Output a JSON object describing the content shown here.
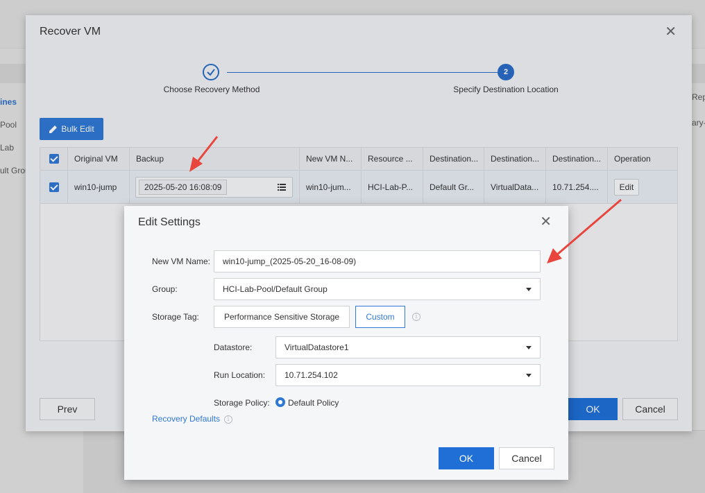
{
  "background": {
    "sidebar": [
      "ines",
      "Pool",
      "Lab",
      "ult Grou"
    ],
    "right_col": [
      "Rep",
      "ary-"
    ]
  },
  "recover_dialog": {
    "title": "Recover VM",
    "steps": [
      {
        "label": "Choose Recovery Method",
        "state": "done"
      },
      {
        "label": "Specify Destination Location",
        "number": "2",
        "state": "active"
      }
    ],
    "bulk_edit_label": "Bulk Edit",
    "table": {
      "columns": [
        "Original VM",
        "Backup",
        "New VM N...",
        "Resource ...",
        "Destination...",
        "Destination...",
        "Destination...",
        "Operation"
      ],
      "rows": [
        {
          "original_vm": "win10-jump",
          "backup": "2025-05-20 16:08:09",
          "new_vm_name": "win10-jum...",
          "resource": "HCI-Lab-P...",
          "dest1": "Default Gr...",
          "dest2": "VirtualData...",
          "dest3": "10.71.254....",
          "operation": "Edit"
        }
      ]
    },
    "prev_label": "Prev",
    "ok_label": "OK",
    "cancel_label": "Cancel"
  },
  "edit_dialog": {
    "title": "Edit Settings",
    "new_vm_name_label": "New VM Name:",
    "new_vm_name_value": "win10-jump_(2025-05-20_16-08-09)",
    "group_label": "Group:",
    "group_value": "HCI-Lab-Pool/Default Group",
    "storage_tag_label": "Storage Tag:",
    "storage_tag_options": [
      "Performance Sensitive Storage",
      "Custom"
    ],
    "storage_tag_selected": "Custom",
    "datastore_label": "Datastore:",
    "datastore_value": "VirtualDatastore1",
    "run_location_label": "Run Location:",
    "run_location_value": "10.71.254.102",
    "storage_policy_label": "Storage Policy:",
    "storage_policy_value": "Default Policy",
    "recovery_defaults_label": "Recovery Defaults",
    "ok_label": "OK",
    "cancel_label": "Cancel"
  },
  "colors": {
    "accent": "#2f78d4",
    "annotation_arrow": "#e8453c"
  }
}
